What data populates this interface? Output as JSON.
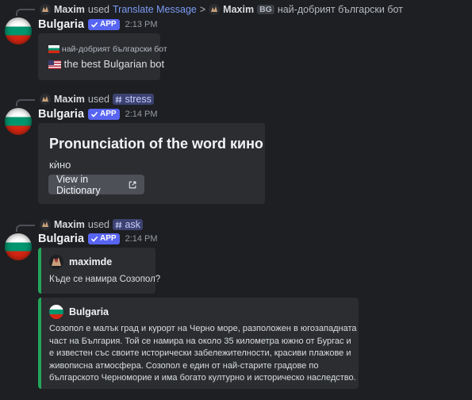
{
  "message1": {
    "reply": {
      "user": "Maxim",
      "used_text": "used",
      "command": "Translate Message",
      "arrow": ">",
      "target_user": "Maxim",
      "lang_tag": "BG",
      "target_text": "най-добрият български бот"
    },
    "author": "Bulgaria",
    "badge": "APP",
    "time": "2:13 PM",
    "original": "най-добрият български бот",
    "translation": "the best Bulgarian bot"
  },
  "message2": {
    "reply": {
      "user": "Maxim",
      "used_text": "used",
      "command": "stress"
    },
    "author": "Bulgaria",
    "badge": "APP",
    "time": "2:14 PM",
    "embed_title": "Pronunciation of the word кино",
    "embed_word": "кѝно",
    "button_label": "View in Dictionary"
  },
  "message3": {
    "reply": {
      "user": "Maxim",
      "used_text": "used",
      "command": "ask"
    },
    "author": "Bulgaria",
    "badge": "APP",
    "time": "2:14 PM",
    "question_author": "maximde",
    "question": "Къде се намира Созопол?",
    "answer_author": "Bulgaria",
    "answer": "Созопол е малък град и курорт на Черно море, разположен в югозападната част на България. Той се намира на около 35 километра южно от Бургас и е известен със своите исторически забележителности, красиви плажове и живописна атмосфера. Созопол е един от най-старите градове по българското Черноморие и има богато културно и историческо наследство."
  },
  "colors": {
    "background": "#1e1f22",
    "card": "#2b2d31",
    "accent": "#5865f2",
    "embed_border": "#23a55a",
    "link": "#7b9cf5"
  },
  "icons": [
    "bot-check-icon",
    "slash-command-icon",
    "external-link-icon",
    "bulgaria-flag-icon",
    "us-flag-icon"
  ]
}
